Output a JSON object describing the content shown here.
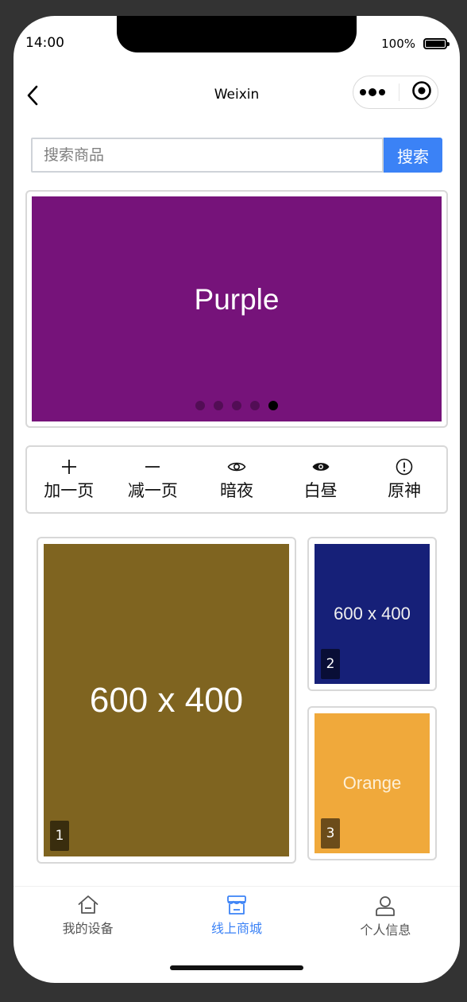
{
  "status_bar": {
    "time": "14:00",
    "battery": "100%"
  },
  "nav": {
    "title": "Weixin"
  },
  "search": {
    "placeholder": "搜索商品",
    "button_label": "搜索"
  },
  "banner": {
    "text": "Purple",
    "color": "#76137a",
    "slide_count": 5,
    "active_index": 4
  },
  "actions": [
    {
      "label": "加一页",
      "icon": "plus-icon"
    },
    {
      "label": "减一页",
      "icon": "minus-icon"
    },
    {
      "label": "暗夜",
      "icon": "eye-outline-icon"
    },
    {
      "label": "白昼",
      "icon": "eye-filled-icon"
    },
    {
      "label": "原神",
      "icon": "exclamation-circle-icon"
    }
  ],
  "tiles": [
    {
      "number": "1",
      "text": "600 x 400",
      "color": "#7f6420"
    },
    {
      "number": "2",
      "text": "600 x 400",
      "color": "#162078"
    },
    {
      "number": "3",
      "text": "Orange",
      "color": "#f0a93b"
    }
  ],
  "tabbar": {
    "active_color": "#3b82f6",
    "items": [
      {
        "label": "我的设备",
        "icon": "home-icon"
      },
      {
        "label": "线上商城",
        "icon": "store-icon",
        "active": true
      },
      {
        "label": "个人信息",
        "icon": "user-icon"
      }
    ]
  }
}
